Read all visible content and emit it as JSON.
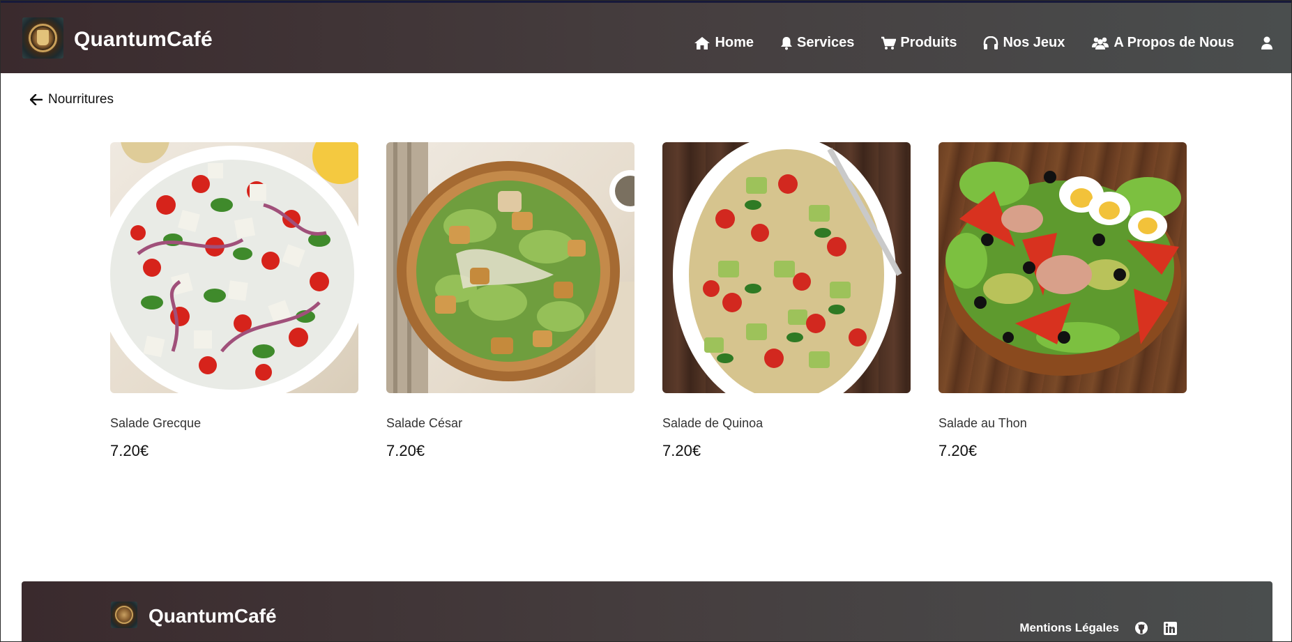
{
  "app": {
    "brand": "QuantumCafé"
  },
  "nav": {
    "items": [
      {
        "label": "Home",
        "icon": "home-icon"
      },
      {
        "label": "Services",
        "icon": "bell-icon"
      },
      {
        "label": "Produits",
        "icon": "cart-icon"
      },
      {
        "label": "Nos Jeux",
        "icon": "headphones-icon"
      },
      {
        "label": "A Propos de Nous",
        "icon": "users-icon"
      }
    ],
    "account_icon": "user-icon"
  },
  "back": {
    "label": "Nourritures",
    "icon": "arrow-left-icon"
  },
  "products": [
    {
      "name": "Salade Grecque",
      "price": "7.20€"
    },
    {
      "name": "Salade César",
      "price": "7.20€"
    },
    {
      "name": "Salade de Quinoa",
      "price": "7.20€"
    },
    {
      "name": "Salade au Thon",
      "price": "7.20€"
    }
  ],
  "footer": {
    "brand": "QuantumCafé",
    "legal_label": "Mentions Légales",
    "icons": [
      "github-icon",
      "linkedin-icon"
    ]
  },
  "colors": {
    "header_start": "#3a2a2d",
    "header_end": "#4a4e4e",
    "text_dark": "#111111"
  }
}
